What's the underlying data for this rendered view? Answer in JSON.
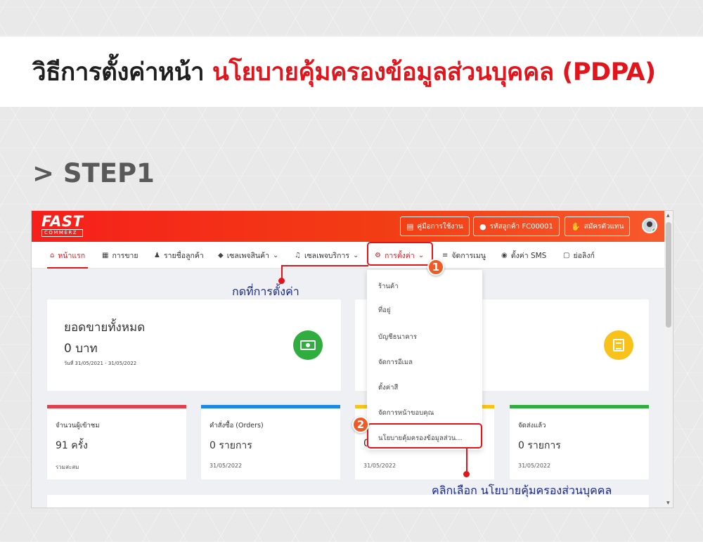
{
  "heading": {
    "main": "วิธีการตั้งค่าหน้า",
    "highlight": "นโยบายคุ้มครองข้อมูลส่วนบุคคล (PDPA)"
  },
  "step_label": "> STEP1",
  "app": {
    "logo": {
      "line1": "FAST",
      "line2": "COMMERZ"
    },
    "top_buttons": [
      {
        "label": "คู่มือการใช้งาน",
        "icon": "book-icon"
      },
      {
        "label": "รหัสลูกค้า FC00001",
        "icon": "user-circle-icon"
      },
      {
        "label": "สมัครตัวแทน",
        "icon": "handshake-icon"
      }
    ],
    "nav": [
      {
        "label": "หน้าแรก",
        "icon": "home-icon"
      },
      {
        "label": "การขาย",
        "icon": "document-icon"
      },
      {
        "label": "รายชื่อลูกค้า",
        "icon": "user-icon"
      },
      {
        "label": "เซลเพจสินค้า",
        "icon": "box-icon"
      },
      {
        "label": "เซลเพจบริการ",
        "icon": "bell-icon"
      },
      {
        "label": "การตั้งค่า",
        "icon": "gear-icon"
      },
      {
        "label": "จัดการเมนู",
        "icon": "list-icon"
      },
      {
        "label": "ตั้งค่า SMS",
        "icon": "chat-icon"
      },
      {
        "label": "ย่อลิงก์",
        "icon": "link-icon"
      }
    ],
    "summary": {
      "title": "ยอดขายทั้งหมด",
      "value": "0 บาท",
      "date_range": "วันที่ 31/05/2021 - 31/05/2022"
    },
    "dropdown": [
      "ร้านค้า",
      "ที่อยู่",
      "บัญชีธนาคาร",
      "จัดการอีเมล",
      "ตั้งค่าสี",
      "จัดการหน้าขอบคุณ",
      "นโยบายคุ้มครองข้อมูลส่วน..."
    ],
    "stats": [
      {
        "label": "จำนวนผู้เข้าชม",
        "value": "91 ครั้ง",
        "sub": "รวมสะสม",
        "color": "#e0414f"
      },
      {
        "label": "คำสั่งซื้อ (Orders)",
        "value": "0 รายการ",
        "sub": "31/05/2022",
        "color": "#1e88e5"
      },
      {
        "label": "",
        "value": "0",
        "sub": "31/05/2022",
        "color": "#f8c21b"
      },
      {
        "label": "จัดส่งแล้ว",
        "value": "0 รายการ",
        "sub": "31/05/2022",
        "color": "#2fae3f"
      }
    ]
  },
  "annotations": {
    "badge1": "1",
    "badge2": "2",
    "callout1": "กดที่การตั้งค่า",
    "callout2": "คลิกเลือก นโยบายคุ้มครองส่วนบุคคล"
  },
  "colors": {
    "accent": "#e3151c",
    "callout_text": "#1b2a8c",
    "badge": "#f05a24"
  }
}
